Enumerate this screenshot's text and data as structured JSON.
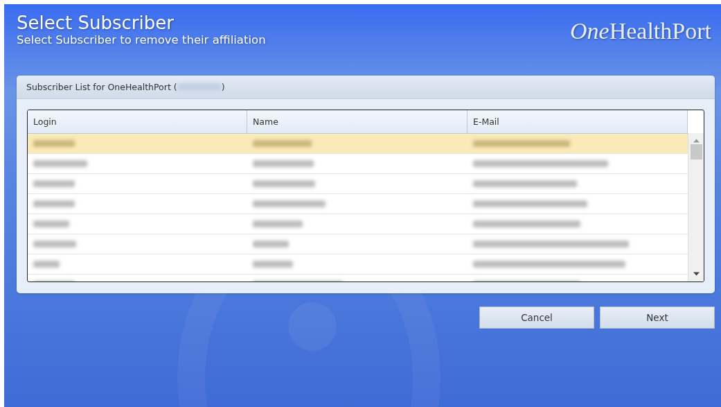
{
  "header": {
    "title": "Select Subscriber",
    "subtitle": "Select Subscriber to remove their affiliation",
    "logo": {
      "italic_part": "One",
      "rest": "HealthPort"
    }
  },
  "panel": {
    "title": "Subscriber List for OneHealthPort (",
    "title_end": ")"
  },
  "table": {
    "columns": [
      "Login",
      "Name",
      "E-Mail"
    ],
    "rows": [
      {
        "selected": true
      },
      {
        "selected": false
      },
      {
        "selected": false
      },
      {
        "selected": false
      },
      {
        "selected": false
      },
      {
        "selected": false
      },
      {
        "selected": false
      },
      {
        "selected": false
      }
    ]
  },
  "buttons": [
    "Cancel",
    "Next"
  ]
}
